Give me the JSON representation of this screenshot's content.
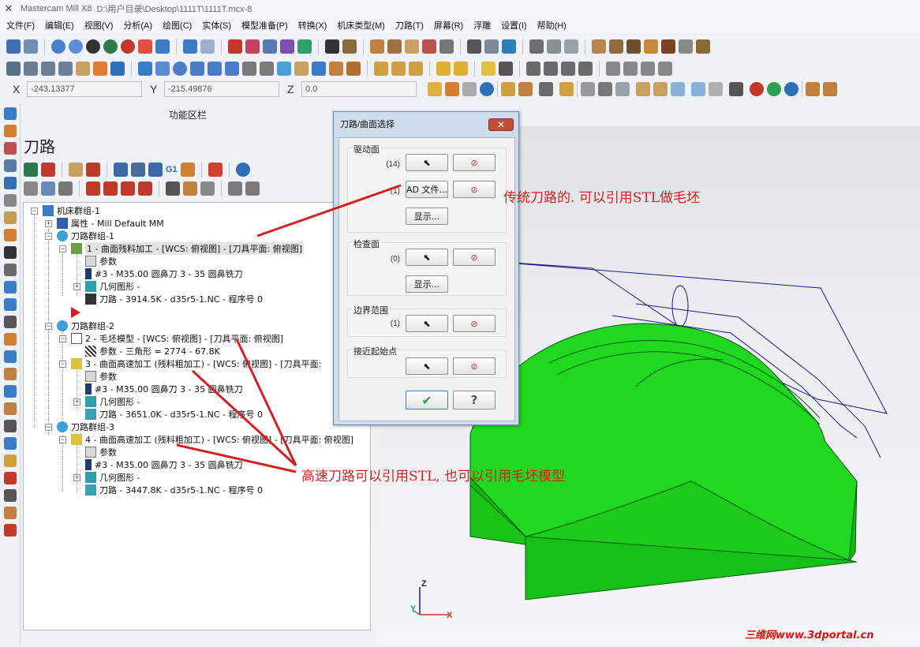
{
  "window": {
    "app_title": "Mastercam Mill X8",
    "file_path": "D:\\用户目录\\Desktop\\1111T\\1111T.mcx-8"
  },
  "menu": [
    "文件(F)",
    "编辑(E)",
    "视图(V)",
    "分析(A)",
    "绘图(C)",
    "实体(S)",
    "模型准备(P)",
    "转换(X)",
    "机床类型(M)",
    "刀路(T)",
    "屏幕(R)",
    "浮雕",
    "设置(I)",
    "帮助(H)"
  ],
  "coords": {
    "x_label": "X",
    "x_value": "-243.13377",
    "y_label": "Y",
    "y_value": "-215.49876",
    "z_label": "Z",
    "z_value": "0.0"
  },
  "func_bar_label": "功能区栏",
  "panel": {
    "title": "刀路",
    "g1_label": "G1"
  },
  "tree": {
    "machine_group": "机床群组-1",
    "properties": "属性 - Mill Default MM",
    "group1": "刀路群组-1",
    "op1": "1 - 曲面残料加工 - [WCS: 俯视图] - [刀具平面: 俯视图]",
    "op1_params": "参数",
    "op1_tool": "#3 - M35.00 圆鼻刀 3 - 35 圆鼻铣刀",
    "op1_geom": "几何图形 -",
    "op1_path": "刀路 - 3914.5K - d35r5-1.NC - 程序号 0",
    "group2": "刀路群组-2",
    "op2": "2 - 毛坯模型 - [WCS: 俯视图] - [刀具平面: 俯视图]",
    "op2_params": "参数 - 三角形 =  2774 - 67.8K",
    "op3": "3 - 曲面高速加工 (残料粗加工) - [WCS: 俯视图] - [刀具平面:",
    "op3_params": "参数",
    "op3_tool": "#3 - M35.00 圆鼻刀 3 - 35 圆鼻铣刀",
    "op3_geom": "几何图形 -",
    "op3_path": "刀路 - 3651.0K - d35r5-1.NC - 程序号 0",
    "group3": "刀路群组-3",
    "op4": "4 - 曲面高速加工 (残料粗加工) - [WCS: 俯视图] - [刀具平面: 俯视图]",
    "op4_params": "参数",
    "op4_tool": "#3 - M35.00 圆鼻刀 3 - 35 圆鼻铣刀",
    "op4_geom": "几何图形 -",
    "op4_path": "刀路 - 3447.8K - d35r5-1.NC - 程序号 0"
  },
  "dialog": {
    "title": "刀路/曲面选择",
    "close": "✕",
    "drive_title": "驱动面",
    "drive_count": "(14)",
    "cad_count": "(1)",
    "cad_button": "AD 文件...",
    "show_button": "显示...",
    "check_title": "检查面",
    "check_count": "(0)",
    "check_show_button": "显示...",
    "boundary_title": "边界范围",
    "boundary_count": "(1)",
    "approach_title": "接近起始点",
    "ok": "✔",
    "help": "?"
  },
  "annotations": {
    "a1": "传统刀路的. 可以引用STL做毛坯",
    "a2": "高速刀路可以引用STL, 也可以引用毛坯模型"
  },
  "axes": {
    "z": "Z",
    "y": "Y",
    "x": "X"
  },
  "watermark": "三维网www.3dportal.cn",
  "colors": {
    "part_green": "#1fd81f",
    "toolpath_blue": "#1a1a8c",
    "annotation_red": "#d42020"
  }
}
